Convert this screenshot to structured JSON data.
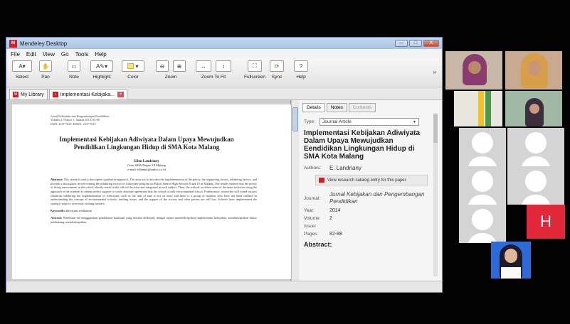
{
  "window": {
    "title": "Mendeley Desktop",
    "logo_text": "M",
    "controls": [
      "—",
      "□",
      "X"
    ]
  },
  "menu": [
    "File",
    "Edit",
    "View",
    "Go",
    "Tools",
    "Help"
  ],
  "toolbar": {
    "select": "Select",
    "pan": "Pan",
    "note": "Note",
    "highlight": "Highlight",
    "color": "Color",
    "zoom": "Zoom",
    "zoom_to_fit": "Zoom To Fit",
    "fullscreen": "Fullscreen",
    "sync": "Sync",
    "help": "Help",
    "more": "»"
  },
  "tabs": {
    "library": "My Library",
    "document": "Implementasi Kebijaka..."
  },
  "document": {
    "journal_line1": "Jurnal Kebijakan dan Pengembangan Pendidikan",
    "journal_line2": "Volume 2, Nomor 1, Januari 2014; 82-88",
    "journal_line3": "ISSN: 2337-7623; EISSN: 2337-7615",
    "title": "Implementasi Kebijakan Adiwiyata Dalam Upaya Mewujudkan Pendidikan Lingkungan Hidup di SMA Kota Malang",
    "author": "Ellen Landriany",
    "affiliation": "Guru SMA Negeri 10 Malang",
    "email": "e-mail: ellenuni@yahoo.co.id",
    "abstract_label": "Abstract:",
    "abstract_text": "This research used a descriptive qualitative approach. The aims are to describe the implementation of the policy, the supporting factors, inhibiting factors, and provide a description in overcoming the inhibiting factors of Adiwiyata program on Public Senior High Schools 8 and 10 in Malang. The results showed that the policy of living environment in the school already stated in the official decision and integrated in each subject. Then, the schools socialize some of the main activities using the approach to the students to obtain perfect support to create absolute agreement that the school is truly environmental school. Furthermore, researcher still found various situations inhibiting the implementation of Adiwiyata, such as the unit of task is not on time, and there is a group of students who have not been realized in understanding the concept of environmental schools, funding issues, and the support of the society and other parties are still low. Schools have implemented the strategic steps to overcome existing barriers.",
    "keywords_label": "Keywords:",
    "keywords_text": "adiwiyata, evaluation",
    "abstrak_label": "Abstrak:",
    "abstrak_text": "Penelitian ini menggunakan pendekatan kualitatif yang bersifat deskriptif, dengan tujuan mendeskripsikan implementasi kebijakan, mendeskripsikan faktor pendukung, mendeskripsikan"
  },
  "details": {
    "tab_details": "Details",
    "tab_notes": "Notes",
    "tab_contents": "Contents",
    "type_label": "Type:",
    "type_value": "Journal Article",
    "title": "Implementasi Kebijakan Adiwiyata Dalam Upaya Mewujudkan Eendidikan Lingkungan Hidup di SMA Kota Malang",
    "authors_label": "Authors:",
    "authors_value": "E. Landriany",
    "catalog_link": "View research catalog entry for this paper",
    "journal_label": "Journal:",
    "journal_value": "Jurnal Kebijakan dan Pengembangan Pendidikan",
    "year_label": "Year:",
    "year_value": "2014",
    "volume_label": "Volume:",
    "volume_value": "2",
    "issue_label": "Issue:",
    "issue_value": "",
    "pages_label": "Pages:",
    "pages_value": "82-88",
    "abstract_heading": "Abstract:"
  },
  "participants": {
    "h_initial": "H"
  }
}
